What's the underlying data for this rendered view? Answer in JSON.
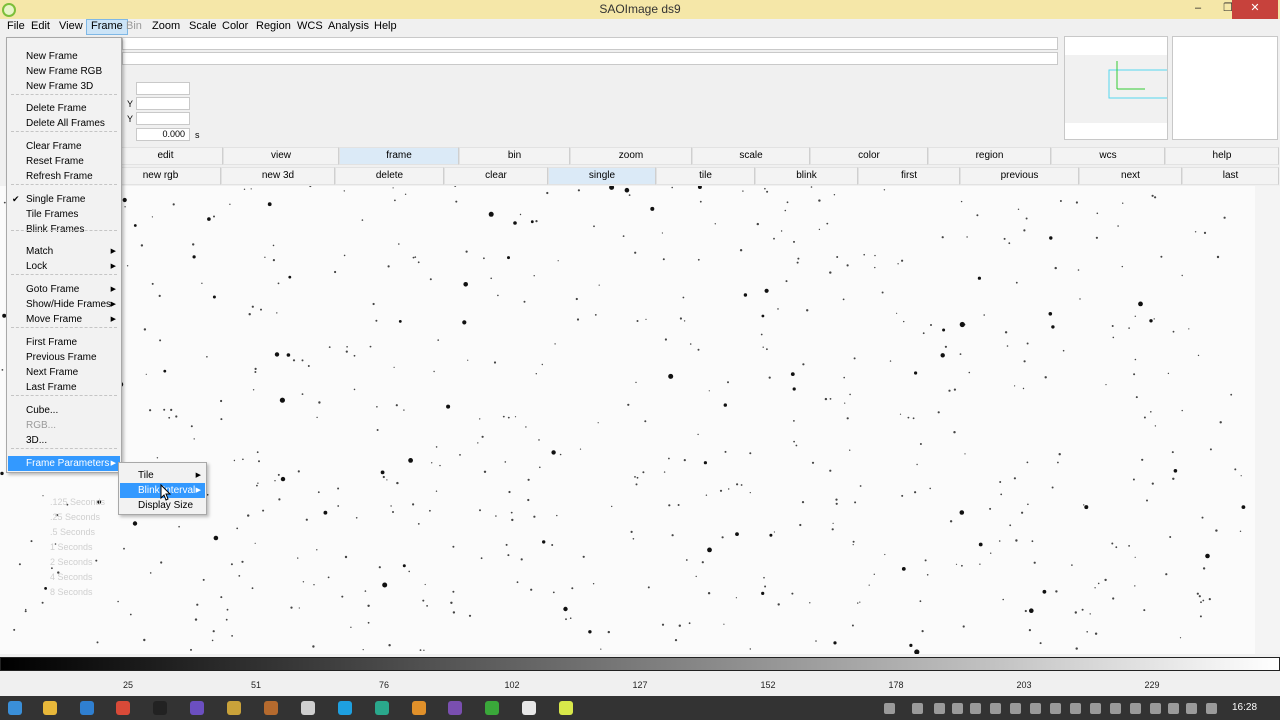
{
  "window": {
    "title": "SAOImage ds9",
    "minimize_label": "–",
    "maximize_label": "❐",
    "close_label": "✕"
  },
  "menubar": {
    "items": [
      {
        "label": "File"
      },
      {
        "label": "Edit"
      },
      {
        "label": "View"
      },
      {
        "label": "Frame"
      },
      {
        "label": "Bin"
      },
      {
        "label": "Zoom"
      },
      {
        "label": "Scale"
      },
      {
        "label": "Color"
      },
      {
        "label": "Region"
      },
      {
        "label": "WCS"
      },
      {
        "label": "Analysis"
      },
      {
        "label": "Help"
      }
    ],
    "active": "Frame",
    "disabled": "Bin"
  },
  "info_panel": {
    "y_label": "Y",
    "value": "0.000",
    "unit": "s"
  },
  "button_bar_major": [
    "edit",
    "view",
    "frame",
    "bin",
    "zoom",
    "scale",
    "color",
    "region",
    "wcs",
    "help"
  ],
  "button_bar_frame": [
    "new rgb",
    "new 3d",
    "delete",
    "clear",
    "single",
    "tile",
    "blink",
    "first",
    "previous",
    "next",
    "last"
  ],
  "active_major": "frame",
  "active_frame": "single",
  "frame_menu": {
    "items": [
      {
        "label": "New Frame"
      },
      {
        "label": "New Frame RGB"
      },
      {
        "label": "New Frame 3D"
      },
      {
        "label": "Delete Frame"
      },
      {
        "label": "Delete All Frames"
      },
      {
        "label": "Clear Frame"
      },
      {
        "label": "Reset Frame"
      },
      {
        "label": "Refresh Frame"
      },
      {
        "label": "Single Frame",
        "checked": true
      },
      {
        "label": "Tile Frames"
      },
      {
        "label": "Blink Frames"
      },
      {
        "label": "Match",
        "submenu": true
      },
      {
        "label": "Lock",
        "submenu": true
      },
      {
        "label": "Goto Frame",
        "submenu": true
      },
      {
        "label": "Show/Hide Frames",
        "submenu": true
      },
      {
        "label": "Move Frame",
        "submenu": true
      },
      {
        "label": "First Frame"
      },
      {
        "label": "Previous Frame"
      },
      {
        "label": "Next Frame"
      },
      {
        "label": "Last Frame"
      },
      {
        "label": "Cube..."
      },
      {
        "label": "RGB...",
        "disabled": true
      },
      {
        "label": "3D..."
      },
      {
        "label": "Frame Parameters",
        "submenu": true,
        "highlighted": true
      }
    ],
    "check_glyph": "✔",
    "arrow_glyph": "▶"
  },
  "frame_parameters_submenu": {
    "items": [
      {
        "label": "Tile",
        "submenu": true
      },
      {
        "label": "Blink Interval",
        "submenu": true,
        "highlighted": true
      },
      {
        "label": "Display Size"
      }
    ]
  },
  "ghost_blink_menu": [
    ".125 Seconds",
    ".25 Seconds",
    ".5 Seconds",
    "1 Seconds",
    "2 Seconds",
    "4 Seconds",
    "8 Seconds"
  ],
  "colorbar": {
    "ticks": [
      "25",
      "51",
      "76",
      "102",
      "127",
      "152",
      "178",
      "203",
      "229"
    ]
  },
  "taskbar": {
    "clock": "16:28"
  }
}
